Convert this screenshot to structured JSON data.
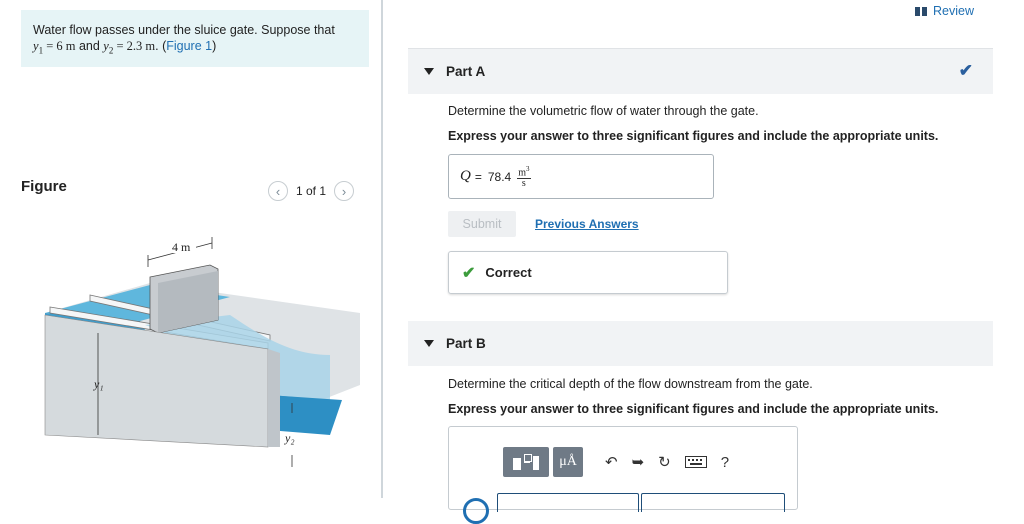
{
  "problem": {
    "intro_line1": "Water flow passes under the sluice gate. Suppose that",
    "y1_var": "y",
    "y1_sub": "1",
    "y1_value": " = 6 m",
    "and_text": " and ",
    "y2_var": "y",
    "y2_sub": "2",
    "y2_value": " = 2.3 m",
    "period": ". (",
    "figure_link": "Figure 1",
    "close_paren": ")"
  },
  "figure": {
    "title": "Figure",
    "pager_text": "1 of 1",
    "label_width": "4 m",
    "label_y1": "y₁",
    "label_y2": "y₂"
  },
  "header": {
    "review_label": "Review"
  },
  "part_a": {
    "title": "Part A",
    "question": "Determine the volumetric flow of water through the gate.",
    "instruction": "Express your answer to three significant figures and include the appropriate units.",
    "answer_var": "Q",
    "answer_eq": "=",
    "answer_value": "78.4",
    "unit_numerator": "m",
    "unit_power": "3",
    "unit_denominator": "s",
    "submit_label": "Submit",
    "previous_answers_label": "Previous Answers",
    "feedback": "Correct"
  },
  "part_b": {
    "title": "Part B",
    "question": "Determine the critical depth of the flow downstream from the gate.",
    "instruction": "Express your answer to three significant figures and include the appropriate units.",
    "toolbar": {
      "units_label": "μÅ",
      "help_label": "?"
    }
  },
  "colors": {
    "accent_link": "#1f6fb2",
    "intro_bg": "#e6f4f6",
    "correct_green": "#3c9c3c",
    "water": "#4aa9d3"
  },
  "icons": [
    "book-icon",
    "checkmark-icon",
    "chevron-left-icon",
    "chevron-right-icon",
    "triangle-down-icon",
    "undo-icon",
    "redo-icon",
    "reset-icon",
    "keyboard-icon"
  ]
}
